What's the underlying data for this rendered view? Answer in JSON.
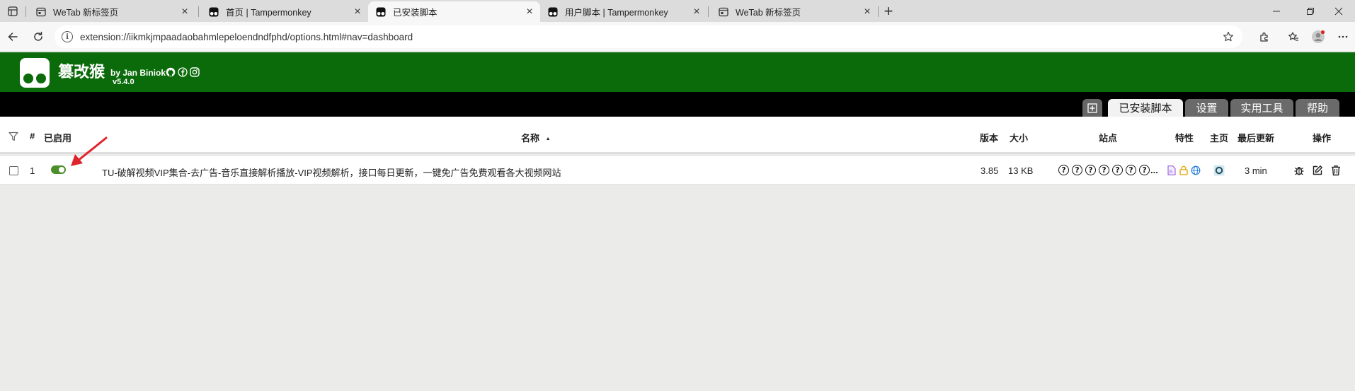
{
  "browser": {
    "tabs": [
      {
        "title": "WeTab 新标签页",
        "favicon": "wetab-icon",
        "active": false
      },
      {
        "title": "首页 | Tampermonkey",
        "favicon": "tampermonkey-icon",
        "active": false
      },
      {
        "title": "已安装脚本",
        "favicon": "tampermonkey-icon",
        "active": true
      },
      {
        "title": "用户脚本 | Tampermonkey",
        "favicon": "tampermonkey-icon",
        "active": false
      },
      {
        "title": "WeTab 新标签页",
        "favicon": "wetab-icon",
        "active": false
      }
    ],
    "close_glyph": "×",
    "new_tab_glyph": "+",
    "url": "extension://iikmkjmpaadaobahmlepeloendndfphd/options.html#nav=dashboard"
  },
  "tampermonkey": {
    "name": "篡改猴",
    "author": "by Jan Biniok",
    "version": "v5.4.0",
    "brand_color": "#0b6b0b",
    "nav_tabs": [
      "已安装脚本",
      "设置",
      "实用工具",
      "帮助"
    ],
    "active_tab": "已安装脚本"
  },
  "table": {
    "headers": {
      "index": "#",
      "enabled": "已启用",
      "name": "名称",
      "sort_indicator": "▲",
      "version": "版本",
      "size": "大小",
      "sites": "站点",
      "features": "特性",
      "homepage": "主页",
      "last_updated": "最后更新",
      "actions": "操作"
    },
    "rows": [
      {
        "index": "1",
        "enabled": true,
        "name": "TU-破解视频VIP集合-去广告-音乐直接解析播放-VIP视频解析，接口每日更新，一键免广告免费观看各大视频网站",
        "version": "3.85",
        "size": "13 KB",
        "site_icon_glyph": "?",
        "sites_ellipsis": "...",
        "features": [
          "script-file-icon",
          "lock-icon",
          "globe-icon"
        ],
        "last_updated": "3 min"
      }
    ]
  },
  "annotation": {
    "arrow_color": "#e0242b",
    "points_to": "enable-toggle"
  }
}
